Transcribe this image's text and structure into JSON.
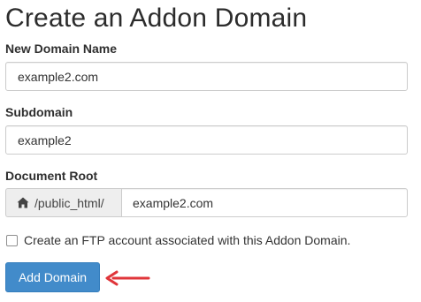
{
  "page": {
    "title": "Create an Addon Domain"
  },
  "form": {
    "new_domain": {
      "label": "New Domain Name",
      "value": "example2.com"
    },
    "subdomain": {
      "label": "Subdomain",
      "value": "example2"
    },
    "document_root": {
      "label": "Document Root",
      "prefix_icon": "home-icon",
      "prefix": "/public_html/",
      "value": "example2.com"
    },
    "ftp_checkbox": {
      "label": "Create an FTP account associated with this Addon Domain.",
      "checked": false
    },
    "submit_label": "Add Domain"
  },
  "annotation": {
    "icon": "arrow-left-icon",
    "color": "#e0353a"
  },
  "colors": {
    "primary_button": "#428bca",
    "addon_background": "#eeeeee",
    "input_border": "#cccccc"
  }
}
